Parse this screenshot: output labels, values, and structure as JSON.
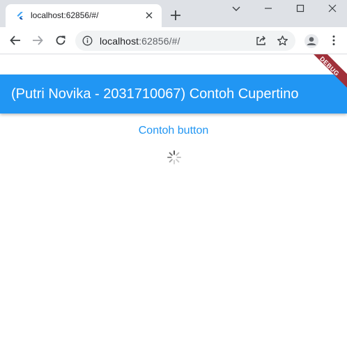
{
  "browser": {
    "tab": {
      "title": "localhost:62856/#/"
    },
    "omnibox": {
      "host": "localhost",
      "rest": ":62856/#/"
    }
  },
  "app": {
    "appbar_title": "(Putri Novika - 2031710067) Contoh Cupertino",
    "button_label": "Contoh button",
    "debug_banner": "DEBUG",
    "colors": {
      "primary": "#2196f3",
      "banner": "#a0303a"
    }
  }
}
